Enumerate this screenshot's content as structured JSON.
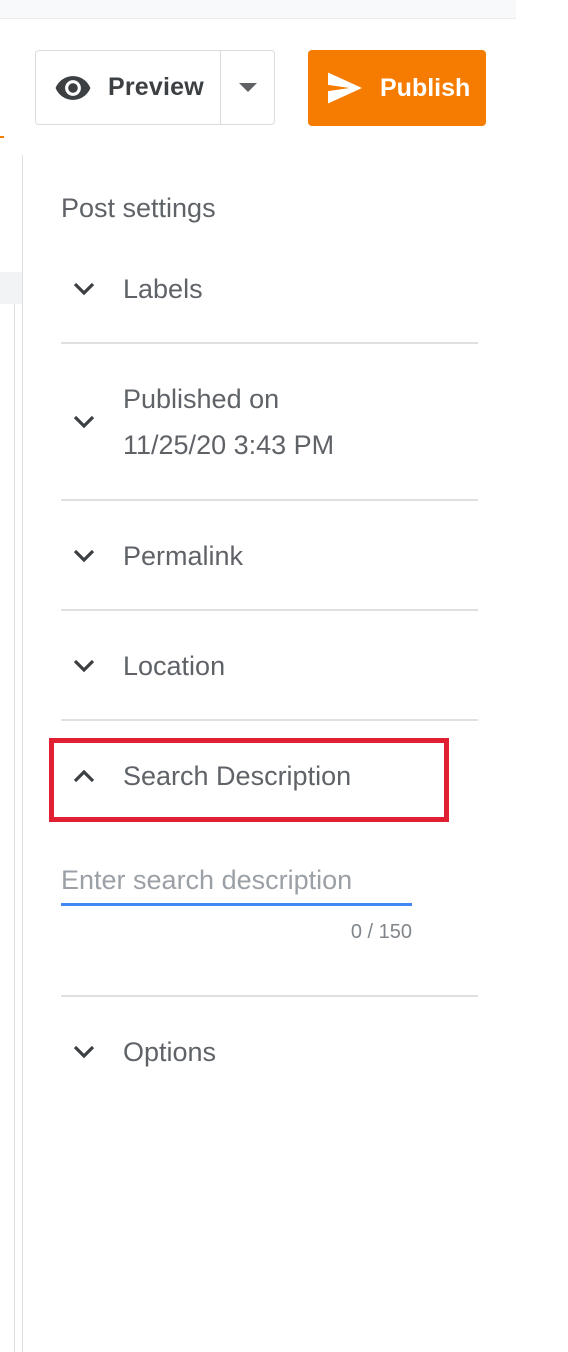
{
  "toolbar": {
    "preview_label": "Preview",
    "publish_label": "Publish",
    "preview_icon": "eye-icon",
    "dropdown_icon": "caret-down-icon",
    "publish_icon": "send-icon"
  },
  "colors": {
    "accent": "#f57c00",
    "highlight": "#e02030",
    "input_focus": "#4285f4",
    "text": "#5f6368"
  },
  "panel": {
    "title": "Post settings",
    "sections": [
      {
        "label": "Labels",
        "expanded": false
      },
      {
        "label_line1": "Published on",
        "label_line2": "11/25/20 3:43 PM",
        "expanded": false
      },
      {
        "label": "Permalink",
        "expanded": false
      },
      {
        "label": "Location",
        "expanded": false
      },
      {
        "label": "Search Description",
        "expanded": true
      },
      {
        "label": "Options",
        "expanded": false
      }
    ],
    "search_description": {
      "value": "",
      "placeholder": "Enter search description",
      "char_count": "0 / 150"
    }
  }
}
